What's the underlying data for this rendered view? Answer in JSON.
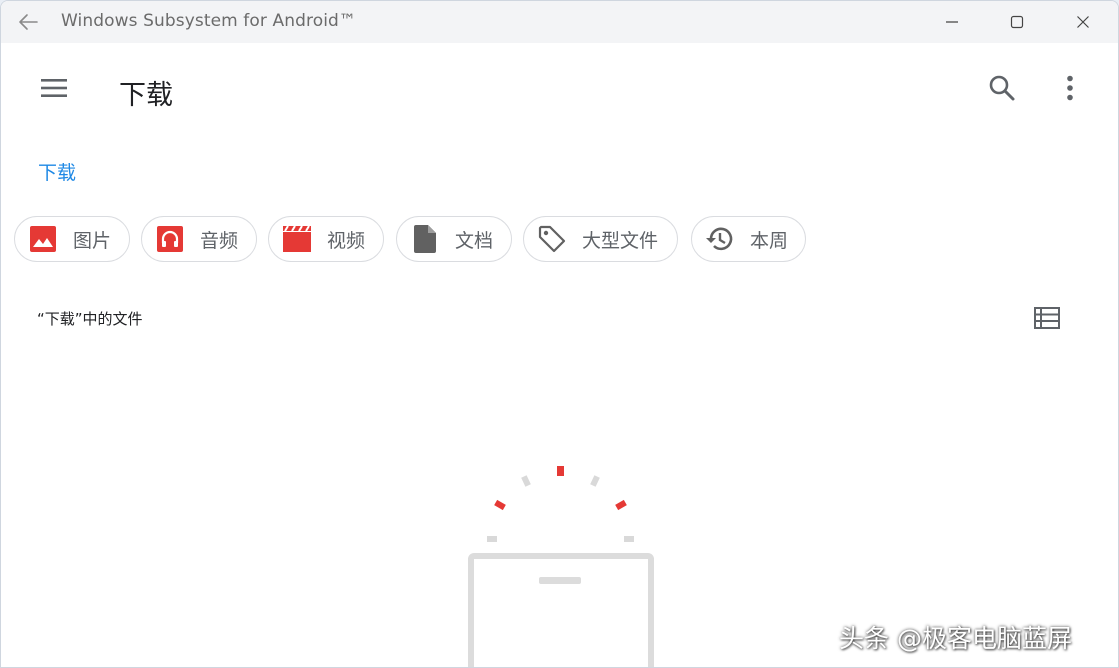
{
  "window": {
    "title": "Windows Subsystem for Android™"
  },
  "appbar": {
    "title": "下载",
    "menu_icon": "hamburger-menu-icon",
    "search_icon": "search-icon",
    "more_icon": "more-vert-icon"
  },
  "breadcrumb": {
    "current": "下载"
  },
  "filters": [
    {
      "label": "图片",
      "icon": "image-icon",
      "color": "#e53935"
    },
    {
      "label": "音频",
      "icon": "headphones-icon",
      "color": "#e53935"
    },
    {
      "label": "视频",
      "icon": "movie-clapper-icon",
      "color": "#e53935"
    },
    {
      "label": "文档",
      "icon": "document-icon",
      "color": "#616161"
    },
    {
      "label": "大型文件",
      "icon": "tag-icon",
      "color": "#616161"
    },
    {
      "label": "本周",
      "icon": "history-icon",
      "color": "#616161"
    }
  ],
  "content": {
    "section_label": "“下载”中的文件",
    "view_toggle_icon": "list-view-icon"
  },
  "watermark": {
    "text": "头条 @极客电脑蓝屏"
  },
  "colors": {
    "accent": "#1e88e5",
    "chip_red": "#e53935",
    "chip_gray": "#616161",
    "titlebar_bg": "#f3f4f6"
  }
}
